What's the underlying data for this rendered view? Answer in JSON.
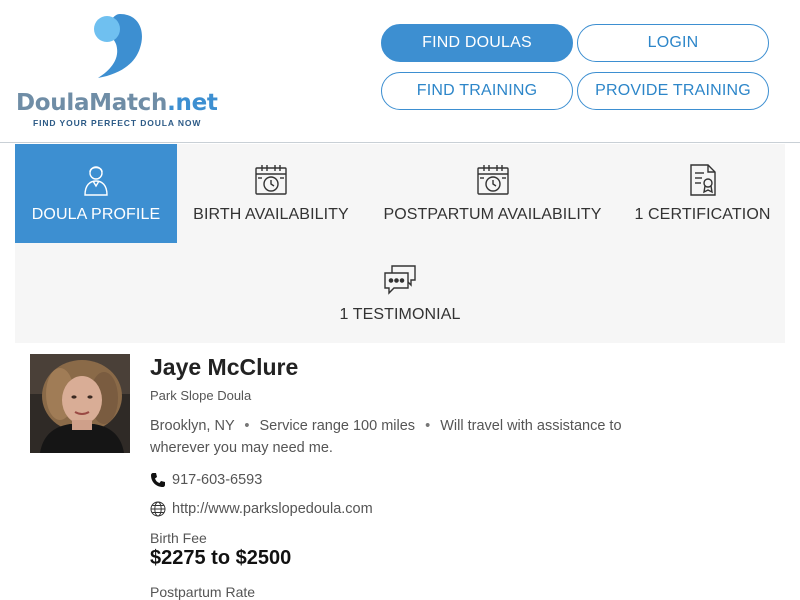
{
  "brand": {
    "name_main": "DoulaMatch",
    "name_tld": ".net",
    "tagline": "FIND YOUR PERFECT DOULA NOW",
    "color_primary": "#3d8fd1",
    "color_light": "#6fc0f0"
  },
  "nav": {
    "find_doulas": "FIND DOULAS",
    "login": "LOGIN",
    "find_training": "FIND TRAINING",
    "provide_training": "PROVIDE TRAINING"
  },
  "tabs": [
    {
      "label": "DOULA PROFILE",
      "icon": "doula-person-icon",
      "active": true
    },
    {
      "label": "BIRTH AVAILABILITY",
      "icon": "calendar-clock-icon",
      "active": false
    },
    {
      "label": "POSTPARTUM AVAILABILITY",
      "icon": "calendar-clock-icon",
      "active": false
    },
    {
      "label": "1 CERTIFICATION",
      "icon": "certificate-icon",
      "active": false
    },
    {
      "label": "1 TESTIMONIAL",
      "icon": "chat-bubbles-icon",
      "active": false
    }
  ],
  "profile": {
    "name": "Jaye McClure",
    "subtitle": "Park Slope Doula",
    "location": "Brooklyn, NY",
    "service_range": "Service range 100 miles",
    "travel_note_1": "Will travel with assistance to",
    "travel_note_2": "wherever you may need me.",
    "phone": "917-603-6593",
    "website": "http://www.parkslopedoula.com",
    "birth_fee_label": "Birth Fee",
    "birth_fee_value": "$2275 to $2500",
    "postpartum_label": "Postpartum Rate"
  }
}
